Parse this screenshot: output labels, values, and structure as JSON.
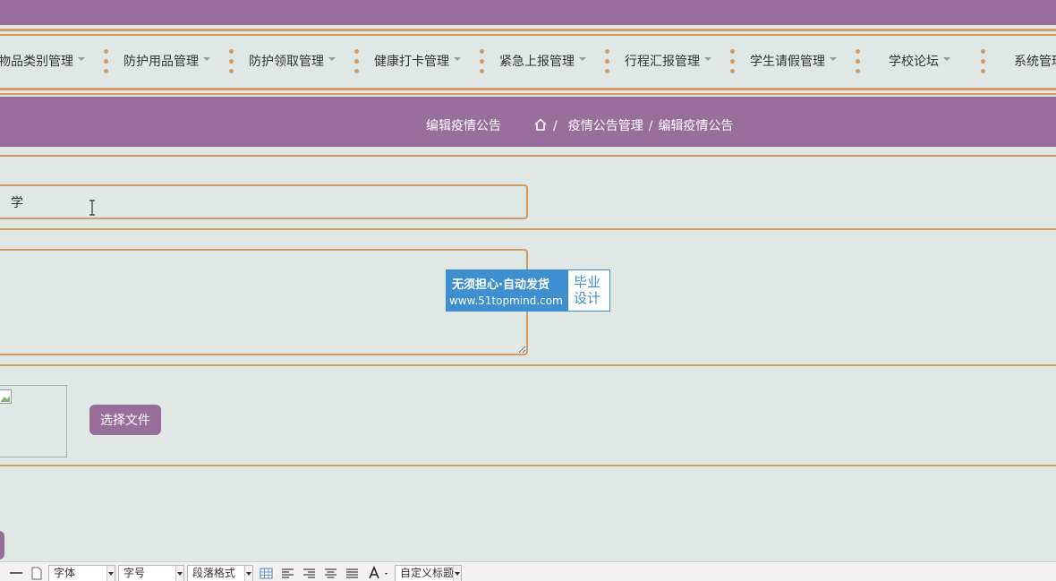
{
  "nav": {
    "items": [
      {
        "label": "物品类别管理"
      },
      {
        "label": "防护用品管理"
      },
      {
        "label": "防护领取管理"
      },
      {
        "label": "健康打卡管理"
      },
      {
        "label": "紧急上报管理"
      },
      {
        "label": "行程汇报管理"
      },
      {
        "label": "学生请假管理"
      },
      {
        "label": "学校论坛"
      },
      {
        "label": "系统管理"
      }
    ]
  },
  "breadcrumb": {
    "page_title": "编辑疫情公告",
    "path": [
      "疫情公告管理",
      "编辑疫情公告"
    ],
    "separator": "/"
  },
  "form": {
    "title_value": "学",
    "upload_button_label": "选择文件"
  },
  "watermark": {
    "line1": "无须担心·自动发货",
    "line2": "www.51topmind.com",
    "right_line1": "毕业",
    "right_line2": "设计"
  },
  "toolbar": {
    "font_family": "字体",
    "font_size": "字号",
    "paragraph": "段落格式",
    "custom_title": "自定义标题"
  },
  "colors": {
    "header_purple": "#986e9b",
    "accent_orange": "#d39a62",
    "background": "#dfe8e4",
    "watermark_blue": "#3d8fcf"
  }
}
